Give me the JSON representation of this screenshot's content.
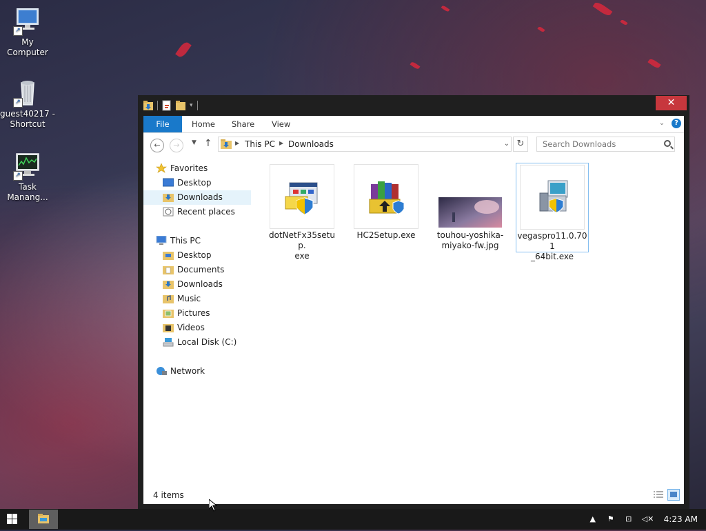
{
  "desktop": {
    "icons": [
      {
        "label": "My Computer",
        "icon": "my-computer-icon"
      },
      {
        "label": "guest40217 - Shortcut",
        "icon": "recycle-bin-icon"
      },
      {
        "label": "Task Manang...",
        "icon": "task-manager-icon"
      }
    ]
  },
  "window": {
    "close_glyph": "✕",
    "ribbon": {
      "tabs": [
        "File",
        "Home",
        "Share",
        "View"
      ]
    },
    "address": {
      "crumbs": [
        "This PC",
        "Downloads"
      ],
      "search_placeholder": "Search Downloads"
    },
    "navpane": {
      "favorites": {
        "label": "Favorites",
        "items": [
          "Desktop",
          "Downloads",
          "Recent places"
        ]
      },
      "thispc": {
        "label": "This PC",
        "items": [
          "Desktop",
          "Documents",
          "Downloads",
          "Music",
          "Pictures",
          "Videos",
          "Local Disk (C:)"
        ]
      },
      "network": {
        "label": "Network"
      },
      "selected": "Downloads"
    },
    "files": [
      {
        "name": "dotNetFx35setup.exe",
        "line1": "dotNetFx35setup.",
        "line2": "exe",
        "icon": "installer-icon"
      },
      {
        "name": "HC2Setup.exe",
        "line1": "HC2Setup.exe",
        "line2": "",
        "icon": "winrar-setup-icon"
      },
      {
        "name": "touhou-yoshika-miyako-fw.jpg",
        "line1": "touhou-yoshika-",
        "line2": "miyako-fw.jpg",
        "icon": "image-thumbnail"
      },
      {
        "name": "vegaspro11.0.701_64bit.exe",
        "line1": "vegaspro11.0.701",
        "line2": "_64bit.exe",
        "icon": "setup-icon",
        "selected": true
      }
    ],
    "status": {
      "items_text": "4 items"
    }
  },
  "taskbar": {
    "clock": "4:23 AM"
  },
  "colors": {
    "accent": "#1979ca",
    "close": "#c7373d",
    "selection": "#e5f3fb",
    "titlebar": "#1f1f1f",
    "taskbar": "#191919"
  }
}
